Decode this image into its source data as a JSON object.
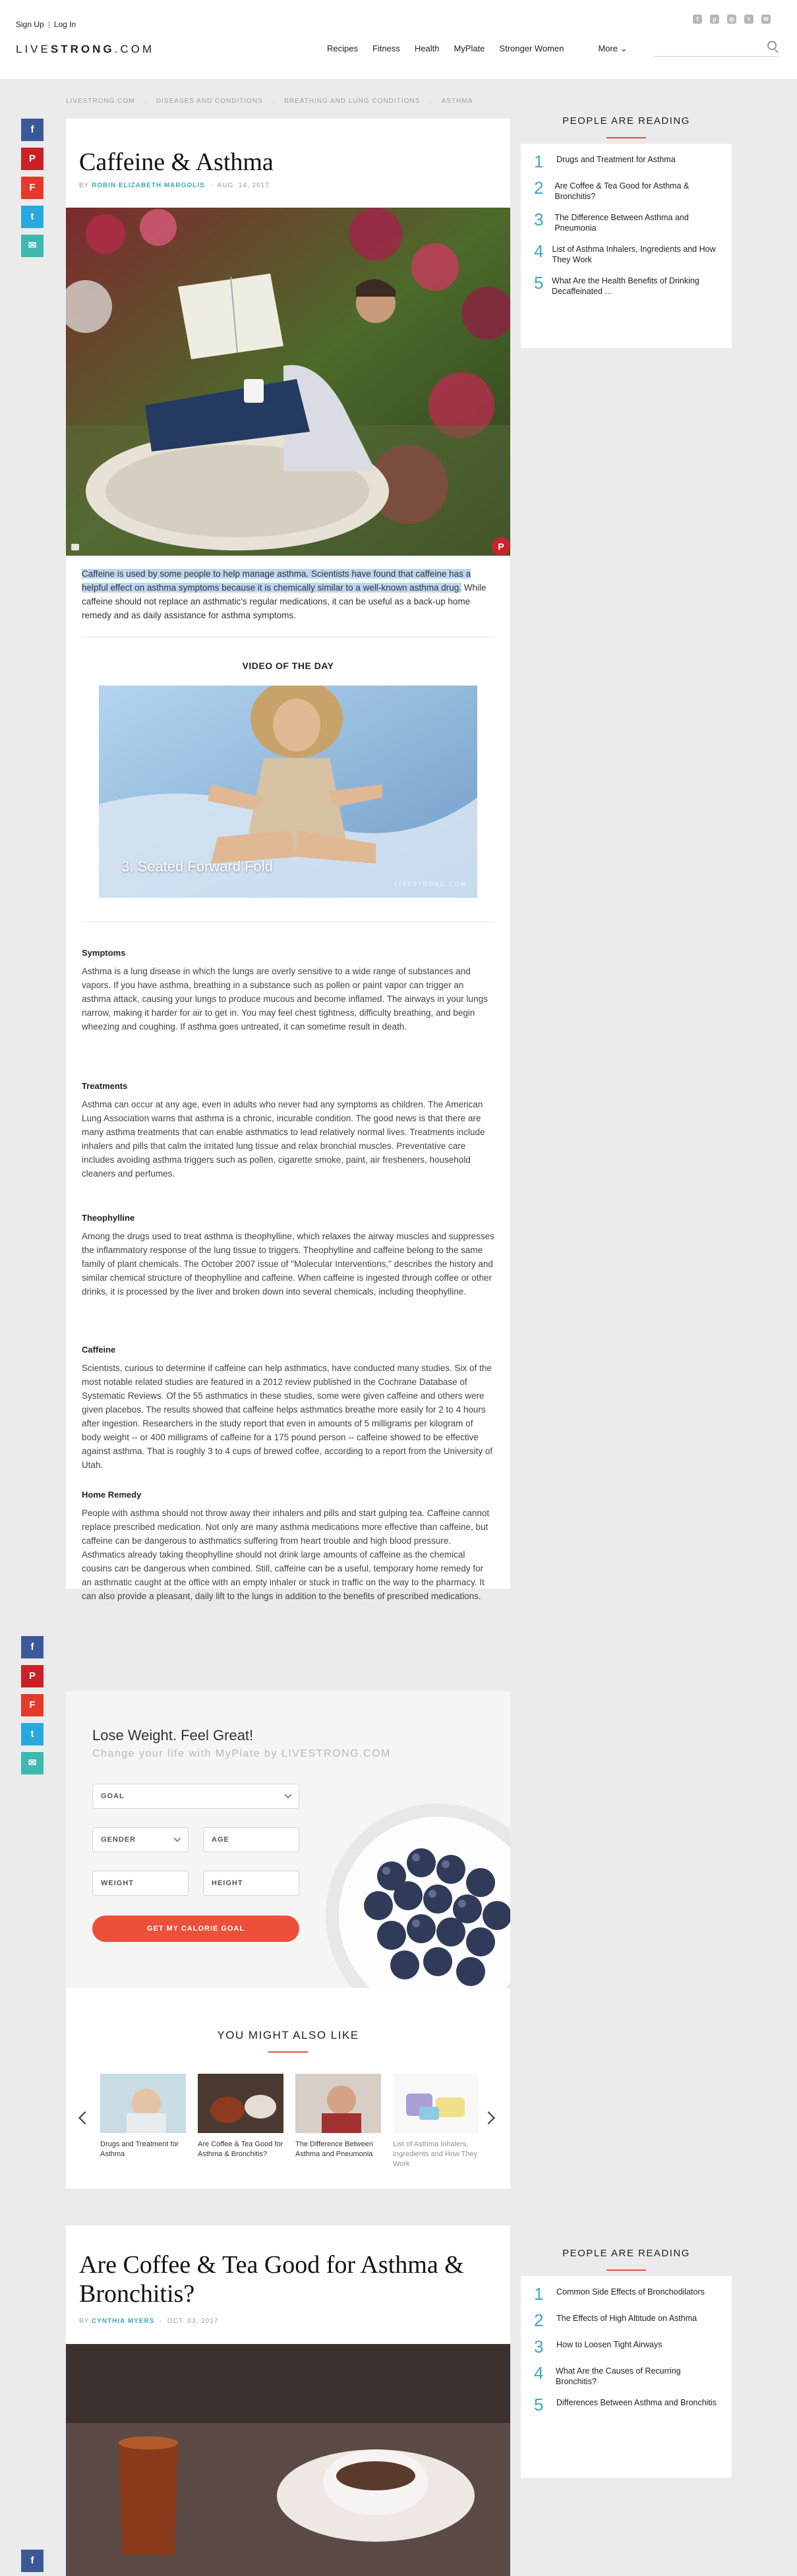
{
  "header": {
    "sign_up": "Sign Up",
    "log_in": "Log In",
    "logo_light": "LIVE",
    "logo_bold": "STRONG",
    "logo_suffix": ".COM",
    "nav": [
      "Recipes",
      "Fitness",
      "Health",
      "MyPlate",
      "Stronger Women"
    ],
    "more": "More",
    "social_icons": [
      "facebook-icon",
      "pinterest-icon",
      "instagram-icon",
      "twitter-icon",
      "email-icon"
    ]
  },
  "breadcrumb": [
    "LIVESTRONG.COM",
    "DISEASES AND CONDITIONS",
    "BREATHING AND LUNG CONDITIONS",
    "ASTHMA"
  ],
  "article": {
    "title": "Caffeine & Asthma",
    "by": "BY",
    "author": "ROBIN ELIZABETH MARGOLIS",
    "date": "AUG. 14, 2017",
    "intro_highlight": "Caffeine is used by some people to help manage asthma. Scientists have found that caffeine has a helpful effect on asthma symptoms because it is chemically similar to a well-known asthma drug.",
    "intro_rest": " While caffeine should not replace an asthmatic's regular medications, it can be useful as a back-up home remedy and as daily assistance for asthma symptoms.",
    "video_heading": "VIDEO OF THE DAY",
    "video_caption": "3. Seated Forward Fold",
    "video_brand": "LIVESTRONG.COM",
    "sections": [
      {
        "heading": "Symptoms",
        "body": "Asthma is a lung disease in which the lungs are overly sensitive to a wide range of substances and vapors. If you have asthma, breathing in a substance such as pollen or paint vapor can trigger an asthma attack, causing your lungs to produce mucous and become inflamed. The airways in your lungs narrow, making it harder for air to get in. You may feel chest tightness, difficulty breathing, and begin wheezing and coughing. If asthma goes untreated, it can sometime result in death."
      },
      {
        "heading": "Treatments",
        "body": "Asthma can occur at any age, even in adults who never had any symptoms as children. The American Lung Association warns that asthma is a chronic, incurable condition. The good news is that there are many asthma treatments that can enable asthmatics to lead relatively normal lives. Treatments include inhalers and pills that calm the irritated lung tissue and relax bronchial muscles. Preventative care includes avoiding asthma triggers such as pollen, cigarette smoke, paint, air fresheners, household cleaners and perfumes."
      },
      {
        "heading": "Theophylline",
        "body": "Among the drugs used to treat asthma is theophylline, which relaxes the airway muscles and suppresses the inflammatory response of the lung tissue to triggers. Theophylline and caffeine belong to the same family of plant chemicals. The October 2007 issue of \"Molecular Interventions,\" describes the history and similar chemical structure of theophylline and caffeine. When caffeine is ingested through coffee or other drinks, it is processed by the liver and broken down into several chemicals, including theophylline."
      },
      {
        "heading": "Caffeine",
        "body": "Scientists, curious to determine if caffeine can help asthmatics, have conducted many studies. Six of the most notable related studies are featured in a 2012 review published in the Cochrane Database of Systematic Reviews. Of the 55 asthmatics in these studies, some were given caffeine and others were given placebos. The results showed that caffeine helps asthmatics breathe more easily for 2 to 4 hours after ingestion. Researchers in the study report that even in amounts of 5 milligrams per kilogram of body weight -- or 400 milligrams of caffeine for a 175 pound person -- caffeine showed to be effective against asthma. That is roughly 3 to 4 cups of brewed coffee, according to a report from the University of Utah."
      },
      {
        "heading": "Home Remedy",
        "body": "People with asthma should not throw away their inhalers and pills and start gulping tea. Caffeine cannot replace prescribed medication. Not only are many asthma medications more effective than caffeine, but caffeine can be dangerous to asthmatics suffering from heart trouble and high blood pressure. Asthmatics already taking theophylline should not drink large amounts of caffeine as the chemical cousins can be dangerous when combined. Still, caffeine can be a useful, temporary home remedy for an asthmatic caught at the office with an empty inhaler or stuck in traffic on the way to the pharmacy. It can also provide a pleasant, daily lift to the lungs in addition to the benefits of prescribed medications."
      }
    ]
  },
  "sidebar1": {
    "heading": "PEOPLE ARE READING",
    "items": [
      {
        "num": "1",
        "text": "Drugs and Treatment for Asthma"
      },
      {
        "num": "2",
        "text": "Are Coffee & Tea Good for Asthma & Bronchitis?"
      },
      {
        "num": "3",
        "text": "The Difference Between Asthma and Pneumonia"
      },
      {
        "num": "4",
        "text": "List of Asthma Inhalers, Ingredients and How They Work"
      },
      {
        "num": "5",
        "text": "What Are the Health Benefits of Drinking Decaffeinated ..."
      }
    ]
  },
  "myplate": {
    "title": "Lose Weight. Feel Great!",
    "subtitle": "Change your life with MyPlate by LIVESTRONG.COM",
    "goal": "GOAL",
    "gender": "GENDER",
    "age": "AGE",
    "weight": "WEIGHT",
    "height": "HEIGHT",
    "button": "GET MY CALORIE GOAL"
  },
  "also_like": {
    "heading": "YOU MIGHT ALSO LIKE",
    "items": [
      {
        "label": "Drugs and Treatment for Asthma"
      },
      {
        "label": "Are Coffee & Tea Good for Asthma & Bronchitis?"
      },
      {
        "label": "The Difference Between Asthma and Pneumonia"
      },
      {
        "label": "List of Asthma Inhalers, Ingredients and How They Work"
      }
    ]
  },
  "article2": {
    "title": "Are Coffee & Tea Good for Asthma & Bronchitis?",
    "by": "BY",
    "author": "CYNTHIA MYERS",
    "date": "OCT. 03, 2017"
  },
  "sidebar2": {
    "heading": "PEOPLE ARE READING",
    "items": [
      {
        "num": "1",
        "text": "Common Side Effects of Bronchodilators"
      },
      {
        "num": "2",
        "text": "The Effects of High Altitude on Asthma"
      },
      {
        "num": "3",
        "text": "How to Loosen Tight Airways"
      },
      {
        "num": "4",
        "text": "What Are the Causes of Recurring Bronchitis?"
      },
      {
        "num": "5",
        "text": "Differences Between Asthma and Bronchitis"
      }
    ]
  },
  "colors": {
    "accent_teal": "#3aa8c1",
    "accent_red": "#e34e3e",
    "facebook": "#3b5998",
    "pinterest": "#cb2027",
    "flipboard": "#e8382b",
    "twitter": "#29a8e0",
    "email": "#3eb8b0"
  }
}
